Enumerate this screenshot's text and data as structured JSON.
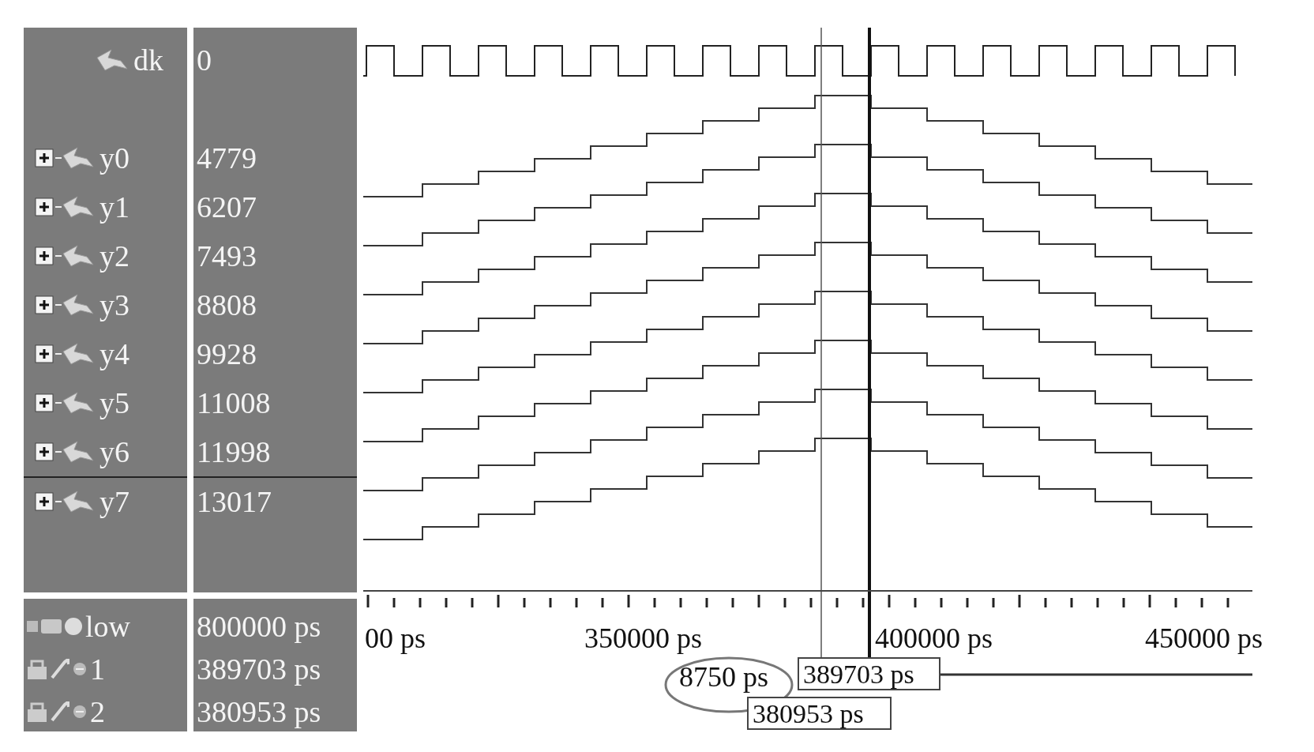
{
  "signals": [
    {
      "name": "dk",
      "value": "0",
      "kind": "bit"
    },
    {
      "name": "y0",
      "value": "4779",
      "kind": "bus",
      "expanded": false
    },
    {
      "name": "y1",
      "value": "6207",
      "kind": "bus",
      "expanded": false
    },
    {
      "name": "y2",
      "value": "7493",
      "kind": "bus",
      "expanded": false
    },
    {
      "name": "y3",
      "value": "8808",
      "kind": "bus",
      "expanded": false
    },
    {
      "name": "y4",
      "value": "9928",
      "kind": "bus",
      "expanded": false
    },
    {
      "name": "y5",
      "value": "11008",
      "kind": "bus",
      "expanded": false
    },
    {
      "name": "y6",
      "value": "11998",
      "kind": "bus",
      "expanded": false
    },
    {
      "name": "y7",
      "value": "13017",
      "kind": "bus",
      "expanded": false
    }
  ],
  "now": {
    "label": "low",
    "value": "800000 ps"
  },
  "cursors": [
    {
      "label": "1",
      "value": "389703 ps",
      "marker_label": "389703 ps"
    },
    {
      "label": "2",
      "value": "380953 ps",
      "marker_label": "380953 ps"
    }
  ],
  "timeline": {
    "labels": [
      "00 ps",
      "350000 ps",
      "400000 ps",
      "450000 ps"
    ]
  },
  "cursor_delta": "8750 ps"
}
